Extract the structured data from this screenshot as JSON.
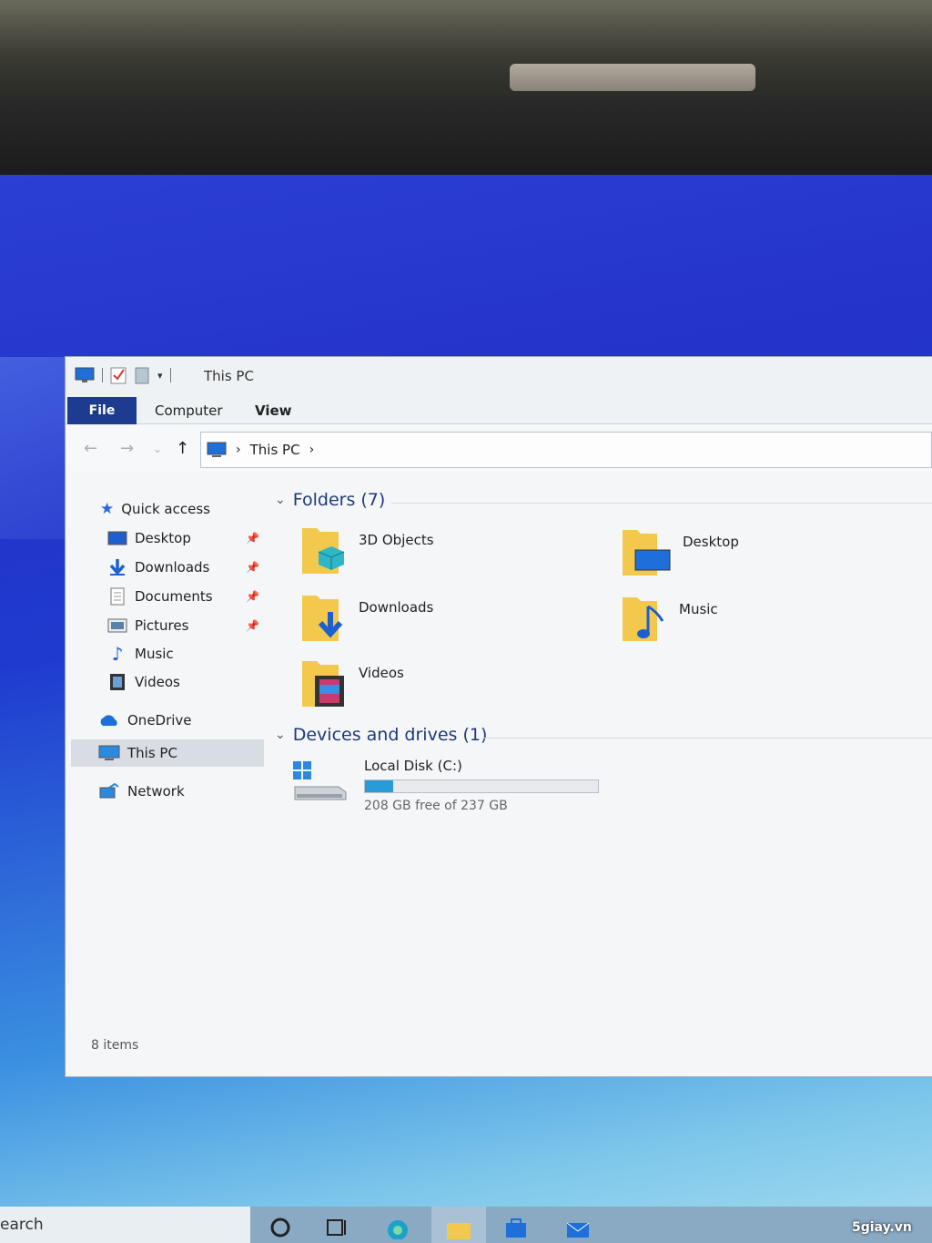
{
  "window": {
    "title": "This PC",
    "tabs": [
      "File",
      "Computer",
      "View"
    ],
    "address": {
      "location": "This PC"
    },
    "status": "8 items"
  },
  "sidebar": {
    "items": [
      {
        "label": "Quick access",
        "icon": "star-icon"
      },
      {
        "label": "Desktop",
        "icon": "desktop-icon",
        "pinned": true
      },
      {
        "label": "Downloads",
        "icon": "download-icon",
        "pinned": true
      },
      {
        "label": "Documents",
        "icon": "document-icon",
        "pinned": true
      },
      {
        "label": "Pictures",
        "icon": "pictures-icon",
        "pinned": true
      },
      {
        "label": "Music",
        "icon": "music-icon"
      },
      {
        "label": "Videos",
        "icon": "videos-icon"
      },
      {
        "label": "OneDrive",
        "icon": "cloud-icon"
      },
      {
        "label": "This PC",
        "icon": "computer-icon",
        "selected": true
      },
      {
        "label": "Network",
        "icon": "network-icon"
      }
    ]
  },
  "folders": {
    "header": "Folders (7)",
    "items": [
      "3D Objects",
      "Desktop",
      "Downloads",
      "Music",
      "Videos"
    ]
  },
  "devices": {
    "header": "Devices and drives (1)",
    "drive": {
      "name": "Local Disk (C:)",
      "free_text": "208 GB free of 237 GB",
      "used_fraction": 0.12
    }
  },
  "taskbar": {
    "search_text": "earch"
  },
  "watermark": "5giay.vn",
  "colors": {
    "accent": "#1d3c8f",
    "drive_fill": "#2a9bd9",
    "folder": "#f2c94c"
  }
}
